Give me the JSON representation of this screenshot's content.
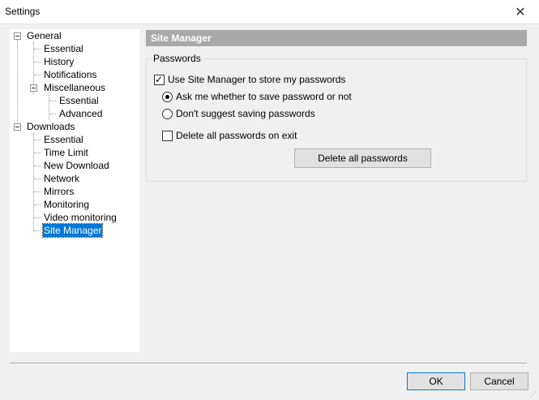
{
  "window": {
    "title": "Settings",
    "close_glyph": "✕"
  },
  "tree": {
    "general": "General",
    "general_children": [
      "Essential",
      "History",
      "Notifications"
    ],
    "misc": "Miscellaneous",
    "misc_children": [
      "Essential",
      "Advanced"
    ],
    "downloads": "Downloads",
    "downloads_children": [
      "Essential",
      "Time Limit",
      "New Download",
      "Network",
      "Mirrors",
      "Monitoring",
      "Video monitoring",
      "Site Manager"
    ],
    "selected": "Site Manager"
  },
  "panel": {
    "header": "Site Manager",
    "group_title": "Passwords",
    "use_site_manager": {
      "label": "Use Site Manager to store my passwords",
      "checked": true
    },
    "radio_ask": {
      "label": "Ask me whether to save password or not",
      "checked": true
    },
    "radio_dont": {
      "label": "Don't suggest saving passwords",
      "checked": false
    },
    "delete_on_exit": {
      "label": "Delete all passwords on exit",
      "checked": false
    },
    "delete_all_button": "Delete all passwords"
  },
  "footer": {
    "ok": "OK",
    "cancel": "Cancel"
  },
  "colors": {
    "selection": "#0078d7",
    "header_bg": "#a9a9a9",
    "dialog_bg": "#f0f0f0"
  }
}
